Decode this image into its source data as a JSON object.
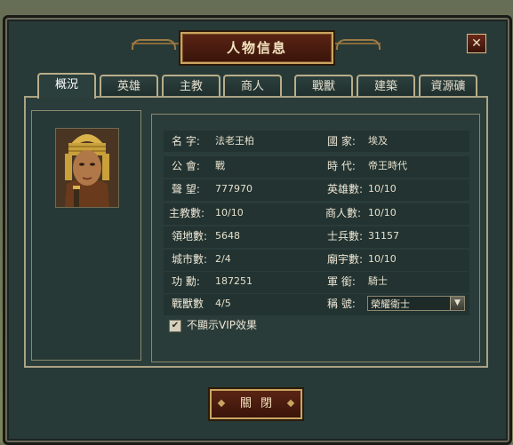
{
  "window": {
    "title": "人物信息",
    "close_glyph": "✕"
  },
  "tabs": [
    {
      "label": "概況",
      "active": true
    },
    {
      "label": "英雄"
    },
    {
      "label": "主教"
    },
    {
      "label": "商人"
    },
    {
      "label": "戰獸"
    },
    {
      "label": "建築"
    },
    {
      "label": "資源礦"
    }
  ],
  "info": {
    "name_label": "名 字:",
    "name_value": "法老王柏",
    "country_label": "國 家:",
    "country_value": "埃及",
    "guild_label": "公 會:",
    "guild_value": "戰",
    "era_label": "時 代:",
    "era_value": "帝王時代",
    "fame_label": "聲 望:",
    "fame_value": "777970",
    "hero_count_label": "英雄數:",
    "hero_count_value": "10/10",
    "bishop_count_label": "主教數:",
    "bishop_count_value": "10/10",
    "merchant_count_label": "商人數:",
    "merchant_count_value": "10/10",
    "territory_label": "領地數:",
    "territory_value": "5648",
    "soldier_label": "士兵數:",
    "soldier_value": "31157",
    "city_label": "城市數:",
    "city_value": "2/4",
    "temple_label": "廟宇數:",
    "temple_value": "10/10",
    "merit_label": "功 勳:",
    "merit_value": "187251",
    "rank_label": "軍 銜:",
    "rank_value": "騎士",
    "beast_label": "戰獸數",
    "beast_value": "4/5",
    "title_label": "稱 號:",
    "title_selected": "榮耀衛士"
  },
  "vip_checkbox": {
    "label": "不顯示VIP效果",
    "checked": true,
    "glyph": "✔"
  },
  "footer": {
    "close_label": "關閉"
  },
  "icons": {
    "portrait": "pharaoh-portrait",
    "dropdown": "▼"
  },
  "colors": {
    "panel": "#283a37",
    "accent_gold": "#c9a562",
    "title_red": "#5a2414"
  }
}
